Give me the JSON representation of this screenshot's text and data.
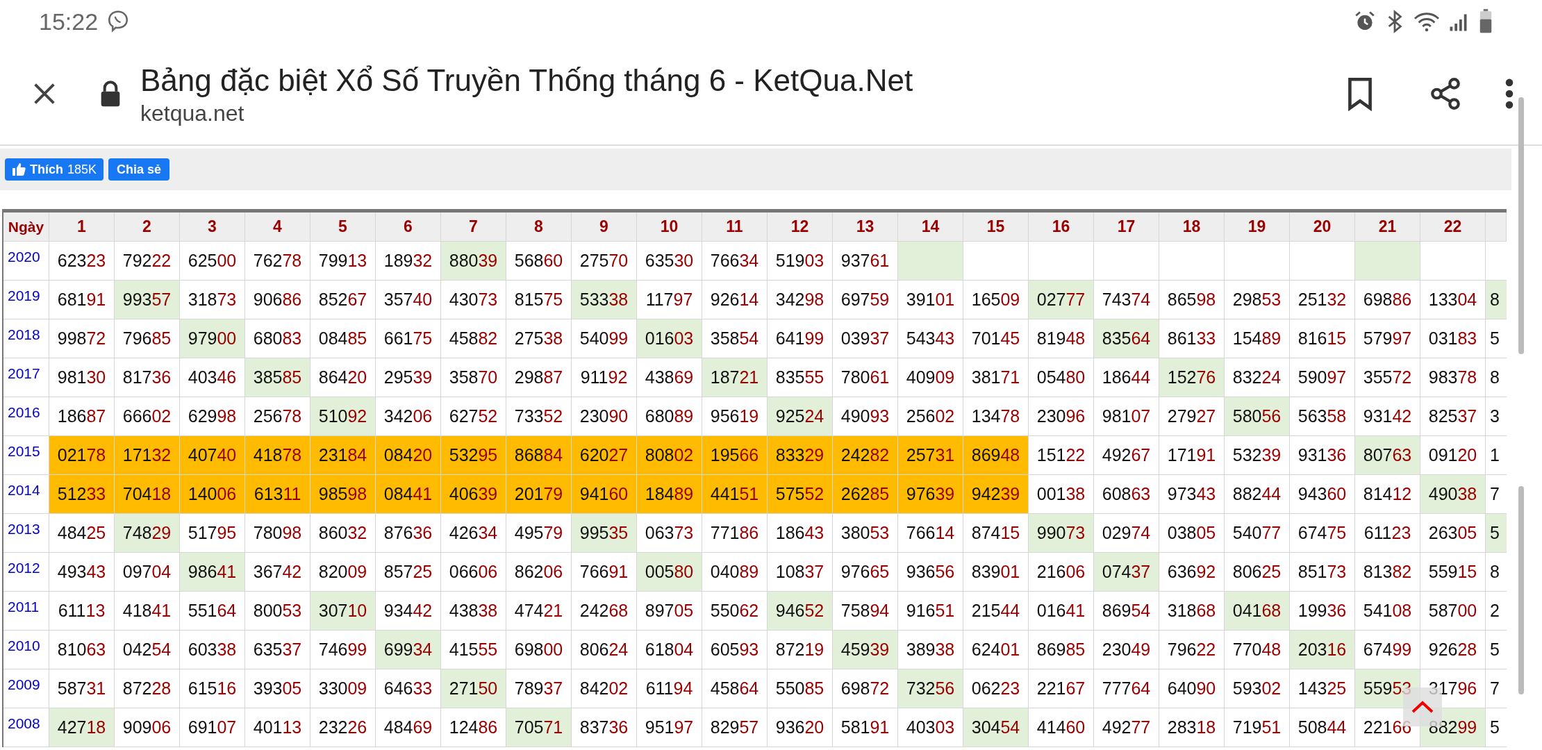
{
  "status_bar": {
    "time": "15:22"
  },
  "browser": {
    "title": "Bảng đặc biệt Xổ Số Truyền Thống tháng 6 - KetQua.Net",
    "url": "ketqua.net"
  },
  "social": {
    "like_label": "Thích",
    "like_count": "185K",
    "share_label": "Chia sẻ"
  },
  "table": {
    "columns": [
      "Ngày",
      "1",
      "2",
      "3",
      "4",
      "5",
      "6",
      "7",
      "8",
      "9",
      "10",
      "11",
      "12",
      "13",
      "14",
      "15",
      "16",
      "17",
      "18",
      "19",
      "20",
      "21",
      "22",
      ""
    ],
    "rows": [
      {
        "cells": [
          {
            "text": "2020",
            "color": "#ffffff"
          },
          {
            "text": "62323",
            "color": "#ffffff"
          },
          {
            "text": "79222",
            "color": "#ffffff"
          },
          {
            "text": "62500",
            "color": "#ffffff"
          },
          {
            "text": "76278",
            "color": "#ffffff"
          },
          {
            "text": "79913",
            "color": "#ffffff"
          },
          {
            "text": "18932",
            "color": "#ffffff"
          },
          {
            "text": "88039",
            "color": "#e2f0d9"
          },
          {
            "text": "56860",
            "color": "#ffffff"
          },
          {
            "text": "27570",
            "color": "#ffffff"
          },
          {
            "text": "63530",
            "color": "#ffffff"
          },
          {
            "text": "76634",
            "color": "#ffffff"
          },
          {
            "text": "51903",
            "color": "#ffffff"
          },
          {
            "text": "93761",
            "color": "#ffffff"
          },
          {
            "text": "",
            "color": "#e2f0d9"
          },
          {
            "text": "",
            "color": "#ffffff"
          },
          {
            "text": "",
            "color": "#ffffff"
          },
          {
            "text": "",
            "color": "#ffffff"
          },
          {
            "text": "",
            "color": "#ffffff"
          },
          {
            "text": "",
            "color": "#ffffff"
          },
          {
            "text": "",
            "color": "#ffffff"
          },
          {
            "text": "",
            "color": "#e2f0d9"
          },
          {
            "text": "",
            "color": "#ffffff"
          },
          {
            "text": "",
            "color": "#ffffff"
          }
        ]
      },
      {
        "cells": [
          {
            "text": "2019",
            "color": "#ffffff"
          },
          {
            "text": "68191",
            "color": "#ffffff"
          },
          {
            "text": "99357",
            "color": "#e2f0d9"
          },
          {
            "text": "31873",
            "color": "#ffffff"
          },
          {
            "text": "90686",
            "color": "#ffffff"
          },
          {
            "text": "85267",
            "color": "#ffffff"
          },
          {
            "text": "35740",
            "color": "#ffffff"
          },
          {
            "text": "43073",
            "color": "#ffffff"
          },
          {
            "text": "81575",
            "color": "#ffffff"
          },
          {
            "text": "53338",
            "color": "#e2f0d9"
          },
          {
            "text": "11797",
            "color": "#ffffff"
          },
          {
            "text": "92614",
            "color": "#ffffff"
          },
          {
            "text": "34298",
            "color": "#ffffff"
          },
          {
            "text": "69759",
            "color": "#ffffff"
          },
          {
            "text": "39101",
            "color": "#ffffff"
          },
          {
            "text": "16509",
            "color": "#ffffff"
          },
          {
            "text": "02777",
            "color": "#e2f0d9"
          },
          {
            "text": "74374",
            "color": "#ffffff"
          },
          {
            "text": "86598",
            "color": "#ffffff"
          },
          {
            "text": "29853",
            "color": "#ffffff"
          },
          {
            "text": "25132",
            "color": "#ffffff"
          },
          {
            "text": "69886",
            "color": "#ffffff"
          },
          {
            "text": "13304",
            "color": "#ffffff"
          },
          {
            "text": "8",
            "color": "#e2f0d9"
          }
        ]
      },
      {
        "cells": [
          {
            "text": "2018",
            "color": "#ffffff"
          },
          {
            "text": "99872",
            "color": "#ffffff"
          },
          {
            "text": "79685",
            "color": "#ffffff"
          },
          {
            "text": "97900",
            "color": "#e2f0d9"
          },
          {
            "text": "68083",
            "color": "#ffffff"
          },
          {
            "text": "08485",
            "color": "#ffffff"
          },
          {
            "text": "66175",
            "color": "#ffffff"
          },
          {
            "text": "45882",
            "color": "#ffffff"
          },
          {
            "text": "27538",
            "color": "#ffffff"
          },
          {
            "text": "54099",
            "color": "#ffffff"
          },
          {
            "text": "01603",
            "color": "#e2f0d9"
          },
          {
            "text": "35854",
            "color": "#ffffff"
          },
          {
            "text": "64199",
            "color": "#ffffff"
          },
          {
            "text": "03937",
            "color": "#ffffff"
          },
          {
            "text": "54343",
            "color": "#ffffff"
          },
          {
            "text": "70145",
            "color": "#ffffff"
          },
          {
            "text": "81948",
            "color": "#ffffff"
          },
          {
            "text": "83564",
            "color": "#e2f0d9"
          },
          {
            "text": "86133",
            "color": "#ffffff"
          },
          {
            "text": "15489",
            "color": "#ffffff"
          },
          {
            "text": "81615",
            "color": "#ffffff"
          },
          {
            "text": "57997",
            "color": "#ffffff"
          },
          {
            "text": "03183",
            "color": "#ffffff"
          },
          {
            "text": "5",
            "color": "#ffffff"
          }
        ]
      },
      {
        "cells": [
          {
            "text": "2017",
            "color": "#ffffff"
          },
          {
            "text": "98130",
            "color": "#ffffff"
          },
          {
            "text": "81736",
            "color": "#ffffff"
          },
          {
            "text": "40346",
            "color": "#ffffff"
          },
          {
            "text": "38585",
            "color": "#e2f0d9"
          },
          {
            "text": "86420",
            "color": "#ffffff"
          },
          {
            "text": "29539",
            "color": "#ffffff"
          },
          {
            "text": "35870",
            "color": "#ffffff"
          },
          {
            "text": "29887",
            "color": "#ffffff"
          },
          {
            "text": "91192",
            "color": "#ffffff"
          },
          {
            "text": "43869",
            "color": "#ffffff"
          },
          {
            "text": "18721",
            "color": "#e2f0d9"
          },
          {
            "text": "83555",
            "color": "#ffffff"
          },
          {
            "text": "78061",
            "color": "#ffffff"
          },
          {
            "text": "40909",
            "color": "#ffffff"
          },
          {
            "text": "38171",
            "color": "#ffffff"
          },
          {
            "text": "05480",
            "color": "#ffffff"
          },
          {
            "text": "18644",
            "color": "#ffffff"
          },
          {
            "text": "15276",
            "color": "#e2f0d9"
          },
          {
            "text": "83224",
            "color": "#ffffff"
          },
          {
            "text": "59097",
            "color": "#ffffff"
          },
          {
            "text": "35572",
            "color": "#ffffff"
          },
          {
            "text": "98378",
            "color": "#ffffff"
          },
          {
            "text": "8",
            "color": "#ffffff"
          }
        ]
      },
      {
        "cells": [
          {
            "text": "2016",
            "color": "#ffffff"
          },
          {
            "text": "18687",
            "color": "#ffffff"
          },
          {
            "text": "66602",
            "color": "#ffffff"
          },
          {
            "text": "62998",
            "color": "#ffffff"
          },
          {
            "text": "25678",
            "color": "#ffffff"
          },
          {
            "text": "51092",
            "color": "#e2f0d9"
          },
          {
            "text": "34206",
            "color": "#ffffff"
          },
          {
            "text": "62752",
            "color": "#ffffff"
          },
          {
            "text": "73352",
            "color": "#ffffff"
          },
          {
            "text": "23090",
            "color": "#ffffff"
          },
          {
            "text": "68089",
            "color": "#ffffff"
          },
          {
            "text": "95619",
            "color": "#ffffff"
          },
          {
            "text": "92524",
            "color": "#e2f0d9"
          },
          {
            "text": "49093",
            "color": "#ffffff"
          },
          {
            "text": "25602",
            "color": "#ffffff"
          },
          {
            "text": "13478",
            "color": "#ffffff"
          },
          {
            "text": "23096",
            "color": "#ffffff"
          },
          {
            "text": "98107",
            "color": "#ffffff"
          },
          {
            "text": "27927",
            "color": "#ffffff"
          },
          {
            "text": "58056",
            "color": "#e2f0d9"
          },
          {
            "text": "56358",
            "color": "#ffffff"
          },
          {
            "text": "93142",
            "color": "#ffffff"
          },
          {
            "text": "82537",
            "color": "#ffffff"
          },
          {
            "text": "3",
            "color": "#ffffff"
          }
        ]
      },
      {
        "cells": [
          {
            "text": "2015",
            "color": "#ffffff"
          },
          {
            "text": "02178",
            "color": "#ffbb00"
          },
          {
            "text": "17132",
            "color": "#ffbb00"
          },
          {
            "text": "40740",
            "color": "#ffbb00"
          },
          {
            "text": "41878",
            "color": "#ffbb00"
          },
          {
            "text": "23184",
            "color": "#ffbb00"
          },
          {
            "text": "08420",
            "color": "#ffbb00"
          },
          {
            "text": "53295",
            "color": "#ffbb00"
          },
          {
            "text": "86884",
            "color": "#ffbb00"
          },
          {
            "text": "62027",
            "color": "#ffbb00"
          },
          {
            "text": "80802",
            "color": "#ffbb00"
          },
          {
            "text": "19566",
            "color": "#ffbb00"
          },
          {
            "text": "83329",
            "color": "#ffbb00"
          },
          {
            "text": "24282",
            "color": "#ffbb00"
          },
          {
            "text": "25731",
            "color": "#ffbb00"
          },
          {
            "text": "86948",
            "color": "#ffbb00"
          },
          {
            "text": "15122",
            "color": "#ffffff"
          },
          {
            "text": "49267",
            "color": "#ffffff"
          },
          {
            "text": "17191",
            "color": "#ffffff"
          },
          {
            "text": "53239",
            "color": "#ffffff"
          },
          {
            "text": "93136",
            "color": "#ffffff"
          },
          {
            "text": "80763",
            "color": "#e2f0d9"
          },
          {
            "text": "09120",
            "color": "#ffffff"
          },
          {
            "text": "1",
            "color": "#ffffff"
          }
        ]
      },
      {
        "cells": [
          {
            "text": "2014",
            "color": "#ffffff"
          },
          {
            "text": "51233",
            "color": "#ffbb00"
          },
          {
            "text": "70418",
            "color": "#ffbb00"
          },
          {
            "text": "14006",
            "color": "#ffbb00"
          },
          {
            "text": "61311",
            "color": "#ffbb00"
          },
          {
            "text": "98598",
            "color": "#ffbb00"
          },
          {
            "text": "08441",
            "color": "#ffbb00"
          },
          {
            "text": "40639",
            "color": "#ffbb00"
          },
          {
            "text": "20179",
            "color": "#ffbb00"
          },
          {
            "text": "94160",
            "color": "#ffbb00"
          },
          {
            "text": "18489",
            "color": "#ffbb00"
          },
          {
            "text": "44151",
            "color": "#ffbb00"
          },
          {
            "text": "57552",
            "color": "#ffbb00"
          },
          {
            "text": "26285",
            "color": "#ffbb00"
          },
          {
            "text": "97639",
            "color": "#ffbb00"
          },
          {
            "text": "94239",
            "color": "#ffbb00"
          },
          {
            "text": "00138",
            "color": "#ffffff"
          },
          {
            "text": "60863",
            "color": "#ffffff"
          },
          {
            "text": "97343",
            "color": "#ffffff"
          },
          {
            "text": "88244",
            "color": "#ffffff"
          },
          {
            "text": "94360",
            "color": "#ffffff"
          },
          {
            "text": "81412",
            "color": "#ffffff"
          },
          {
            "text": "49038",
            "color": "#e2f0d9"
          },
          {
            "text": "7",
            "color": "#ffffff"
          }
        ]
      },
      {
        "cells": [
          {
            "text": "2013",
            "color": "#ffffff"
          },
          {
            "text": "48425",
            "color": "#ffffff"
          },
          {
            "text": "74829",
            "color": "#e2f0d9"
          },
          {
            "text": "51795",
            "color": "#ffffff"
          },
          {
            "text": "78098",
            "color": "#ffffff"
          },
          {
            "text": "86032",
            "color": "#ffffff"
          },
          {
            "text": "87636",
            "color": "#ffffff"
          },
          {
            "text": "42634",
            "color": "#ffffff"
          },
          {
            "text": "49579",
            "color": "#ffffff"
          },
          {
            "text": "99535",
            "color": "#e2f0d9"
          },
          {
            "text": "06373",
            "color": "#ffffff"
          },
          {
            "text": "77186",
            "color": "#ffffff"
          },
          {
            "text": "18643",
            "color": "#ffffff"
          },
          {
            "text": "38053",
            "color": "#ffffff"
          },
          {
            "text": "76614",
            "color": "#ffffff"
          },
          {
            "text": "87415",
            "color": "#ffffff"
          },
          {
            "text": "99073",
            "color": "#e2f0d9"
          },
          {
            "text": "02974",
            "color": "#ffffff"
          },
          {
            "text": "03805",
            "color": "#ffffff"
          },
          {
            "text": "54077",
            "color": "#ffffff"
          },
          {
            "text": "67475",
            "color": "#ffffff"
          },
          {
            "text": "61123",
            "color": "#ffffff"
          },
          {
            "text": "26305",
            "color": "#ffffff"
          },
          {
            "text": "5",
            "color": "#e2f0d9"
          }
        ]
      },
      {
        "cells": [
          {
            "text": "2012",
            "color": "#ffffff"
          },
          {
            "text": "49343",
            "color": "#ffffff"
          },
          {
            "text": "09704",
            "color": "#ffffff"
          },
          {
            "text": "98641",
            "color": "#e2f0d9"
          },
          {
            "text": "36742",
            "color": "#ffffff"
          },
          {
            "text": "82009",
            "color": "#ffffff"
          },
          {
            "text": "85725",
            "color": "#ffffff"
          },
          {
            "text": "06606",
            "color": "#ffffff"
          },
          {
            "text": "86206",
            "color": "#ffffff"
          },
          {
            "text": "76691",
            "color": "#ffffff"
          },
          {
            "text": "00580",
            "color": "#e2f0d9"
          },
          {
            "text": "04089",
            "color": "#ffffff"
          },
          {
            "text": "10837",
            "color": "#ffffff"
          },
          {
            "text": "97665",
            "color": "#ffffff"
          },
          {
            "text": "93656",
            "color": "#ffffff"
          },
          {
            "text": "83901",
            "color": "#ffffff"
          },
          {
            "text": "21606",
            "color": "#ffffff"
          },
          {
            "text": "07437",
            "color": "#e2f0d9"
          },
          {
            "text": "63692",
            "color": "#ffffff"
          },
          {
            "text": "80625",
            "color": "#ffffff"
          },
          {
            "text": "85173",
            "color": "#ffffff"
          },
          {
            "text": "81382",
            "color": "#ffffff"
          },
          {
            "text": "55915",
            "color": "#ffffff"
          },
          {
            "text": "8",
            "color": "#ffffff"
          }
        ]
      },
      {
        "cells": [
          {
            "text": "2011",
            "color": "#ffffff"
          },
          {
            "text": "61113",
            "color": "#ffffff"
          },
          {
            "text": "41841",
            "color": "#ffffff"
          },
          {
            "text": "55164",
            "color": "#ffffff"
          },
          {
            "text": "80053",
            "color": "#ffffff"
          },
          {
            "text": "30710",
            "color": "#e2f0d9"
          },
          {
            "text": "93442",
            "color": "#ffffff"
          },
          {
            "text": "43838",
            "color": "#ffffff"
          },
          {
            "text": "47421",
            "color": "#ffffff"
          },
          {
            "text": "24268",
            "color": "#ffffff"
          },
          {
            "text": "89705",
            "color": "#ffffff"
          },
          {
            "text": "55062",
            "color": "#ffffff"
          },
          {
            "text": "94652",
            "color": "#e2f0d9"
          },
          {
            "text": "75894",
            "color": "#ffffff"
          },
          {
            "text": "91651",
            "color": "#ffffff"
          },
          {
            "text": "21544",
            "color": "#ffffff"
          },
          {
            "text": "01641",
            "color": "#ffffff"
          },
          {
            "text": "86954",
            "color": "#ffffff"
          },
          {
            "text": "31868",
            "color": "#ffffff"
          },
          {
            "text": "04168",
            "color": "#e2f0d9"
          },
          {
            "text": "19936",
            "color": "#ffffff"
          },
          {
            "text": "54108",
            "color": "#ffffff"
          },
          {
            "text": "58700",
            "color": "#ffffff"
          },
          {
            "text": "2",
            "color": "#ffffff"
          }
        ]
      },
      {
        "cells": [
          {
            "text": "2010",
            "color": "#ffffff"
          },
          {
            "text": "81063",
            "color": "#ffffff"
          },
          {
            "text": "04254",
            "color": "#ffffff"
          },
          {
            "text": "60338",
            "color": "#ffffff"
          },
          {
            "text": "63537",
            "color": "#ffffff"
          },
          {
            "text": "74699",
            "color": "#ffffff"
          },
          {
            "text": "69934",
            "color": "#e2f0d9"
          },
          {
            "text": "41555",
            "color": "#ffffff"
          },
          {
            "text": "69800",
            "color": "#ffffff"
          },
          {
            "text": "80624",
            "color": "#ffffff"
          },
          {
            "text": "61804",
            "color": "#ffffff"
          },
          {
            "text": "60593",
            "color": "#ffffff"
          },
          {
            "text": "87219",
            "color": "#ffffff"
          },
          {
            "text": "45939",
            "color": "#e2f0d9"
          },
          {
            "text": "38938",
            "color": "#ffffff"
          },
          {
            "text": "62401",
            "color": "#ffffff"
          },
          {
            "text": "86985",
            "color": "#ffffff"
          },
          {
            "text": "23049",
            "color": "#ffffff"
          },
          {
            "text": "79622",
            "color": "#ffffff"
          },
          {
            "text": "77048",
            "color": "#ffffff"
          },
          {
            "text": "20316",
            "color": "#e2f0d9"
          },
          {
            "text": "67499",
            "color": "#ffffff"
          },
          {
            "text": "92628",
            "color": "#ffffff"
          },
          {
            "text": "5",
            "color": "#ffffff"
          }
        ]
      },
      {
        "cells": [
          {
            "text": "2009",
            "color": "#ffffff"
          },
          {
            "text": "58731",
            "color": "#ffffff"
          },
          {
            "text": "87228",
            "color": "#ffffff"
          },
          {
            "text": "61516",
            "color": "#ffffff"
          },
          {
            "text": "39305",
            "color": "#ffffff"
          },
          {
            "text": "33009",
            "color": "#ffffff"
          },
          {
            "text": "64633",
            "color": "#ffffff"
          },
          {
            "text": "27150",
            "color": "#e2f0d9"
          },
          {
            "text": "78937",
            "color": "#ffffff"
          },
          {
            "text": "84202",
            "color": "#ffffff"
          },
          {
            "text": "61194",
            "color": "#ffffff"
          },
          {
            "text": "45864",
            "color": "#ffffff"
          },
          {
            "text": "55085",
            "color": "#ffffff"
          },
          {
            "text": "69872",
            "color": "#ffffff"
          },
          {
            "text": "73256",
            "color": "#e2f0d9"
          },
          {
            "text": "06223",
            "color": "#ffffff"
          },
          {
            "text": "22167",
            "color": "#ffffff"
          },
          {
            "text": "77764",
            "color": "#ffffff"
          },
          {
            "text": "64090",
            "color": "#ffffff"
          },
          {
            "text": "59302",
            "color": "#ffffff"
          },
          {
            "text": "14325",
            "color": "#ffffff"
          },
          {
            "text": "55953",
            "color": "#e2f0d9"
          },
          {
            "text": "31796",
            "color": "#ffffff"
          },
          {
            "text": "7",
            "color": "#ffffff"
          }
        ]
      },
      {
        "cells": [
          {
            "text": "2008",
            "color": "#ffffff"
          },
          {
            "text": "42718",
            "color": "#e2f0d9"
          },
          {
            "text": "90906",
            "color": "#ffffff"
          },
          {
            "text": "69107",
            "color": "#ffffff"
          },
          {
            "text": "40113",
            "color": "#ffffff"
          },
          {
            "text": "23226",
            "color": "#ffffff"
          },
          {
            "text": "48469",
            "color": "#ffffff"
          },
          {
            "text": "12486",
            "color": "#ffffff"
          },
          {
            "text": "70571",
            "color": "#e2f0d9"
          },
          {
            "text": "83736",
            "color": "#ffffff"
          },
          {
            "text": "95197",
            "color": "#ffffff"
          },
          {
            "text": "82957",
            "color": "#ffffff"
          },
          {
            "text": "93620",
            "color": "#ffffff"
          },
          {
            "text": "58191",
            "color": "#ffffff"
          },
          {
            "text": "40303",
            "color": "#ffffff"
          },
          {
            "text": "30454",
            "color": "#e2f0d9"
          },
          {
            "text": "41460",
            "color": "#ffffff"
          },
          {
            "text": "49277",
            "color": "#ffffff"
          },
          {
            "text": "28318",
            "color": "#ffffff"
          },
          {
            "text": "71951",
            "color": "#ffffff"
          },
          {
            "text": "50844",
            "color": "#ffffff"
          },
          {
            "text": "22166",
            "color": "#ffffff"
          },
          {
            "text": "88299",
            "color": "#e2f0d9"
          },
          {
            "text": "5",
            "color": "#ffffff"
          }
        ]
      }
    ]
  }
}
